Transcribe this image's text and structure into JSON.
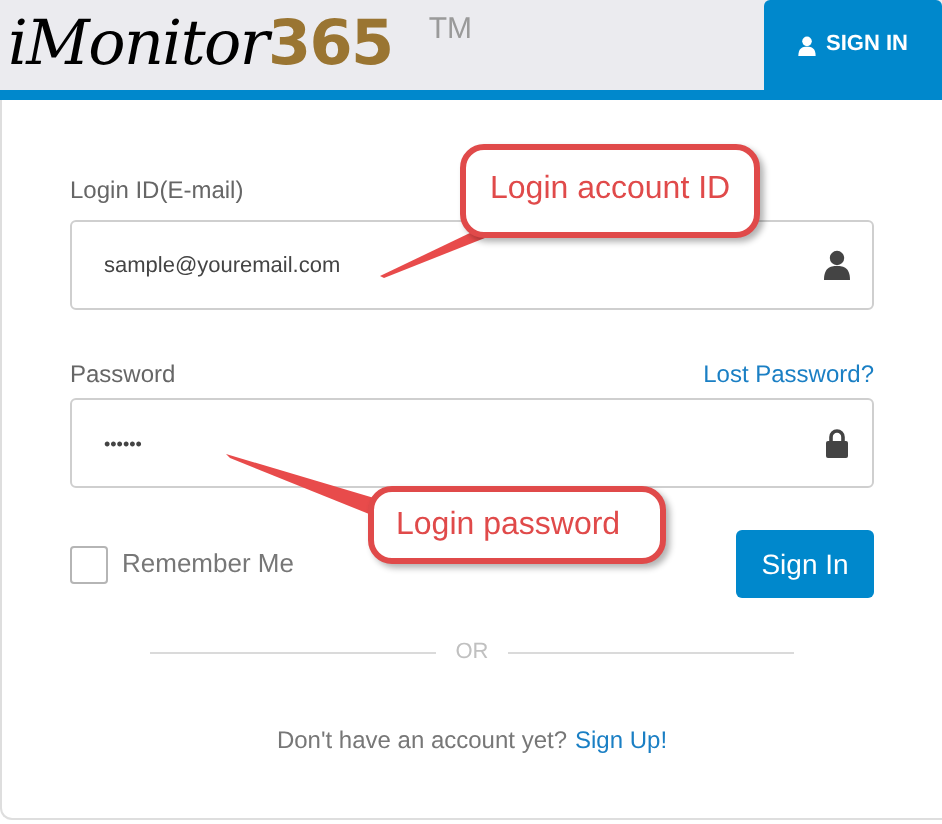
{
  "logo": {
    "text": "iMonitor",
    "number": "365",
    "trademark": "TM"
  },
  "tab": {
    "label": "SIGN IN",
    "selected": true
  },
  "login_field": {
    "label": "Login ID(E-mail)",
    "value": "sample@youremail.com"
  },
  "password_field": {
    "label": "Password",
    "value": "••••••",
    "link": "Lost Password?"
  },
  "remember_me": {
    "label": "Remember Me",
    "checked": false
  },
  "sign_in_button": "Sign In",
  "divider": "OR",
  "signup": {
    "text": "Don't have an account yet?",
    "link": "Sign Up!"
  },
  "callouts": [
    {
      "text": "Login account ID"
    },
    {
      "text": "Login password"
    }
  ]
}
